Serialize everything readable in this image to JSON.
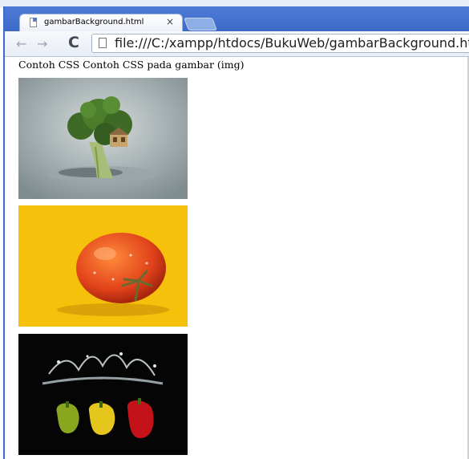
{
  "browser": {
    "tab_title": "gambarBackground.html",
    "close_glyph": "×",
    "url": "file:///C:/xampp/htdocs/BukuWeb/gambarBackground.html"
  },
  "nav": {
    "back": "←",
    "forward": "→",
    "reload": "C"
  },
  "page": {
    "heading": "Contoh CSS Contoh CSS pada gambar (img)",
    "images": [
      "broccoli-treehouse",
      "tomato",
      "peppers-splash"
    ]
  },
  "colors": {
    "tabbar": "#4d7bd6",
    "broccoli_bg": "#b8c4c6",
    "tomato_bg": "#f6c10a",
    "peppers_bg": "#050505"
  }
}
